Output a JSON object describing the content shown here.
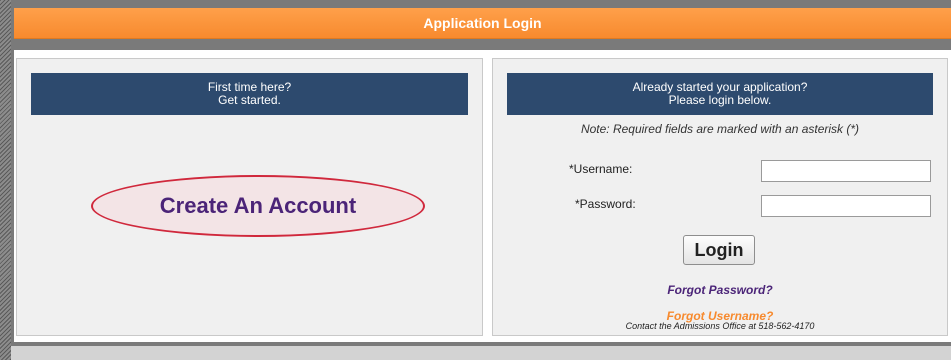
{
  "title": "Application Login",
  "new_user": {
    "header_line1": "First time here?",
    "header_line2": "Get started.",
    "create_account_label": "Create An Account"
  },
  "existing_user": {
    "header_line1": "Already started your application?",
    "header_line2": "Please login below.",
    "note": "Note: Required fields are marked with an asterisk (*)",
    "username_label": "*Username:",
    "username_value": "",
    "password_label": "*Password:",
    "password_value": "",
    "login_label": "Login",
    "forgot_password": "Forgot Password?",
    "forgot_username": "Forgot Username?",
    "contact": "Contact the Admissions Office at 518-562-4170"
  },
  "colors": {
    "title_bar": "#f78a2e",
    "panel_header": "#2d4a6e",
    "create_account_text": "#4b2478",
    "create_account_oval": "#d0283c",
    "forgot_username": "#f78a2e"
  }
}
